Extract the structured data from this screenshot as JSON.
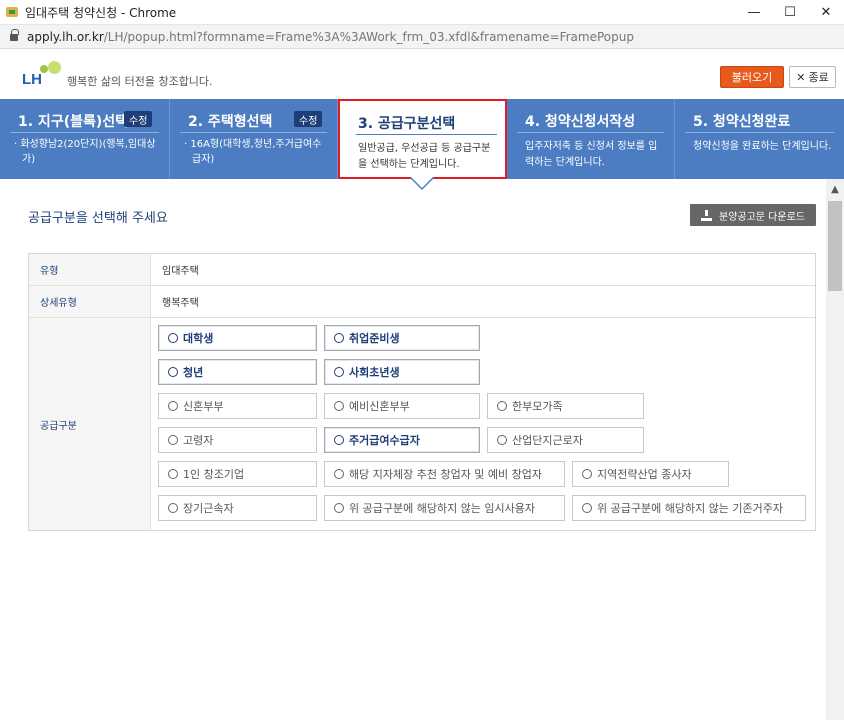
{
  "window": {
    "title": "임대주택 청약신청 - Chrome",
    "minimize": "—",
    "maximize": "☐",
    "close": "✕"
  },
  "address": {
    "host": "apply.lh.or.kr",
    "path": "/LH/popup.html?formname=Frame%3A%3AWork_frm_03.xfdl&framename=FramePopup"
  },
  "header": {
    "logo_text": "LH",
    "slogan": "행복한 삶의 터전을 창조합니다.",
    "load_button": "불러오기",
    "close_icon": "✕",
    "close_button": "종료"
  },
  "steps": [
    {
      "title": "1. 지구(블록)선택",
      "edit": "수정",
      "selection": "· 화성향남2(20단지)(행복,임대상가)"
    },
    {
      "title": "2. 주택형선택",
      "edit": "수정",
      "selection": "· 16A형(대학생,청년,주거급여수급자)"
    },
    {
      "title": "3. 공급구분선택",
      "desc": "일반공급, 우선공급 등 공급구분을 선택하는 단계입니다."
    },
    {
      "title": "4. 청약신청서작성",
      "desc": "입주자저축 등 신청서 정보를 입력하는 단계입니다."
    },
    {
      "title": "5. 청약신청완료",
      "desc": "청약신청을 완료하는 단계입니다."
    }
  ],
  "main": {
    "section_title": "공급구분을 선택해 주세요",
    "download_button": "분양공고문 다운로드",
    "rows": [
      {
        "label": "유형",
        "value": "임대주택"
      },
      {
        "label": "상세유형",
        "value": "행복주택"
      },
      {
        "label": "공급구분"
      }
    ],
    "options": [
      "대학생",
      "취업준비생",
      "청년",
      "사회초년생",
      "신혼부부",
      "예비신혼부부",
      "한부모가족",
      "고령자",
      "주거급여수급자",
      "산업단지근로자",
      "1인 창조기업",
      "해당 지자체장 추천 창업자 및 예비 창업자",
      "지역전략산업 종사자",
      "장기근속자",
      "위 공급구분에 해당하지 않는 임시사용자",
      "위 공급구분에 해당하지 않는 기존거주자"
    ]
  },
  "colors": {
    "step_bar": "#4c7dc3",
    "active_border": "#e31b23",
    "load_button": "#e85a1c",
    "navy": "#1f3e78"
  }
}
